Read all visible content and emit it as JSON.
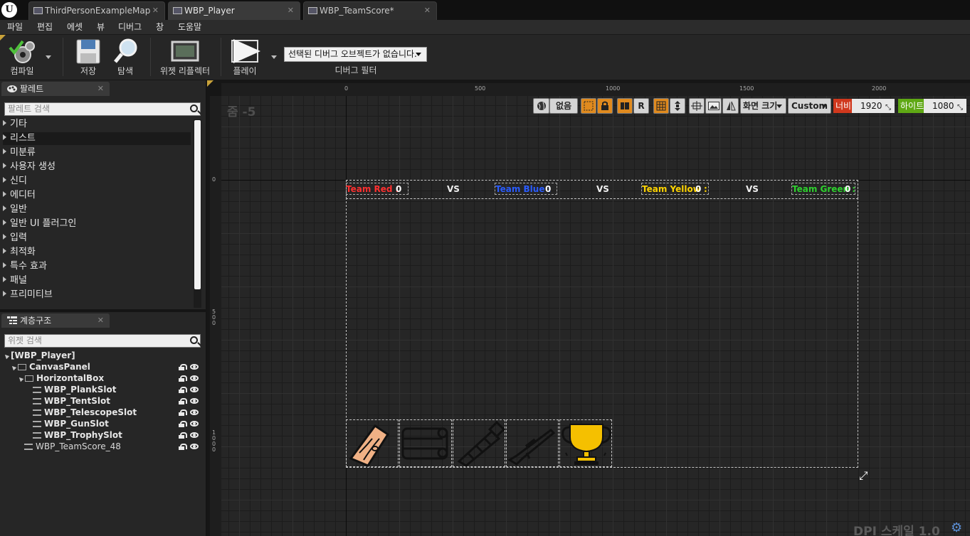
{
  "tabs": [
    {
      "label": "ThirdPersonExampleMap",
      "active": false
    },
    {
      "label": "WBP_Player",
      "active": true
    },
    {
      "label": "WBP_TeamScore*",
      "active": false
    }
  ],
  "logo": "U",
  "tab_close_glyph": "✕",
  "menu": [
    "파일",
    "편집",
    "에셋",
    "뷰",
    "디버그",
    "창",
    "도움말"
  ],
  "toolbar": {
    "compile": "컴파일",
    "save": "저장",
    "browse": "탐색",
    "widget_reflector": "위젯 리플렉터",
    "play": "플레이",
    "debug_object": "선택된 디버그 오브젝트가 없습니다.",
    "debug_filter": "디버그 필터"
  },
  "palette": {
    "title": "팔레트",
    "search_placeholder": "팔레트 검색",
    "categories": [
      "기타",
      "리스트",
      "미분류",
      "사용자 생성",
      "신디",
      "에디터",
      "일반",
      "일반 UI 플러그인",
      "입력",
      "최적화",
      "특수 효과",
      "패널",
      "프리미티브"
    ],
    "selected": "리스트"
  },
  "hierarchy": {
    "title": "계층구조",
    "search_placeholder": "위젯 검색",
    "root": "[WBP_Player]",
    "canvas": "CanvasPanel",
    "hbox": "HorizontalBox",
    "slots": [
      "WBP_PlankSlot",
      "WBP_TentSlot",
      "WBP_TelescopeSlot",
      "WBP_GunSlot",
      "WBP_TrophySlot"
    ],
    "teamscore": "WBP_TeamScore_48"
  },
  "designer": {
    "zoom": "줌 -5",
    "none_button": "없음",
    "r_button": "R",
    "screen_size": "화면 크기",
    "custom": "Custom",
    "width_label": "너비",
    "width_value": "1920",
    "height_label": "하이트",
    "height_value": "1080",
    "dpi_scale": "DPI 스케일 1.0",
    "ruler_top": [
      "0",
      "500",
      "1000",
      "1500",
      "2000"
    ],
    "ruler_left": [
      "0",
      "5\n0\n0",
      "1\n0\n0\n0"
    ]
  },
  "teams": [
    {
      "name": "Team Red :",
      "score": "0",
      "color": "#ff3030"
    },
    {
      "name": "Team Blue :",
      "score": "0",
      "color": "#2a5cff"
    },
    {
      "name": "Team Yellow :",
      "score": "0",
      "color": "#ffd400"
    },
    {
      "name": "Team Green :",
      "score": "0",
      "color": "#2ed12e"
    }
  ],
  "vs_label": "VS",
  "inventory_icons": [
    "plank-icon",
    "tent-icon",
    "telescope-icon",
    "rifle-icon",
    "trophy-icon"
  ],
  "colors": {
    "accent_orange": "#e08a1e",
    "width_red": "#d0381d",
    "height_green": "#5fa814",
    "trophy_gold": "#f5c000"
  }
}
